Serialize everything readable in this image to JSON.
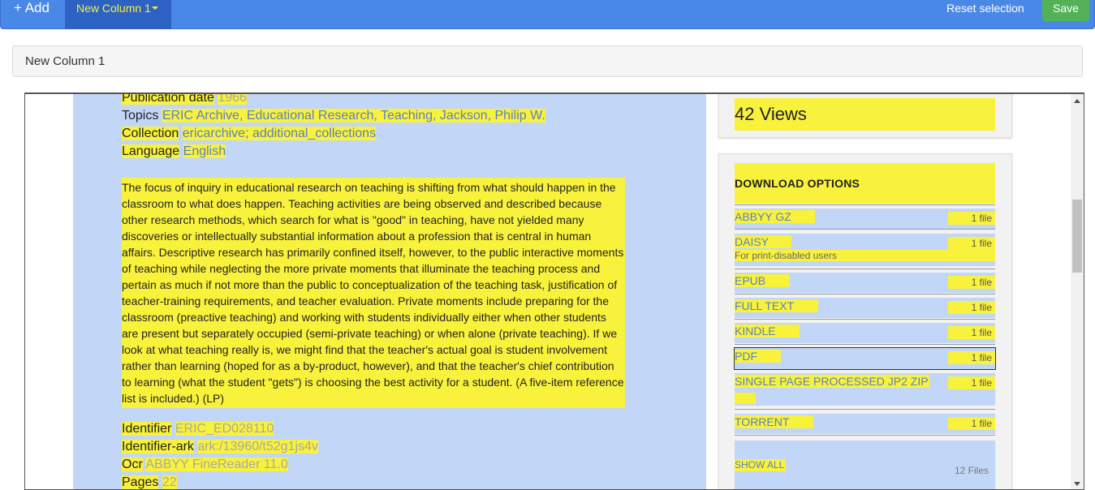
{
  "toolbar": {
    "add_label": "+ Add",
    "column_label": "New Column 1",
    "reset_label": "Reset selection",
    "save_label": "Save"
  },
  "column_name": "New Column 1",
  "metadata": {
    "publication_date": {
      "label": "Publication date",
      "value": "1966"
    },
    "topics": {
      "label": "Topics",
      "value": "ERIC Archive, Educational Research, Teaching, Jackson, Philip W."
    },
    "collection": {
      "label": "Collection",
      "value": "ericarchive; additional_collections"
    },
    "language": {
      "label": "Language",
      "value": "English"
    },
    "identifier": {
      "label": "Identifier",
      "value": "ERIC_ED028110"
    },
    "identifier_ark": {
      "label": "Identifier-ark",
      "value": "ark:/13960/t52g1js4v"
    },
    "ocr": {
      "label": "Ocr",
      "value": "ABBYY FineReader 11.0"
    },
    "pages": {
      "label": "Pages",
      "value": "22"
    }
  },
  "description": "The focus of inquiry in educational research on teaching is shifting from what should happen in the classroom to what does happen. Teaching activities are being observed and described because other research methods, which search for what is \"good\" in teaching, have not yielded many discoveries or intellectually substantial information about a profession that is central in human affairs. Descriptive research has primarily confined itself, however, to the public interactive moments of teaching while neglecting the more private moments that illuminate the teaching process and pertain as much if not more than the public to conceptualization of the teaching task, justification of teacher-training requirements, and teacher evaluation. Private moments include preparing for the classroom (preactive teaching) and working with students individually either when other students are present but separately occupied (semi-private teaching) or when alone (private teaching). If we look at what teaching really is, we might find that the teacher's actual goal is student involvement rather than learning (hoped for as a by-product, however), and that the teacher's chief contribution to learning (what the student \"gets\") is choosing the best activity for a student. (A five-item reference list is included.) (LP)",
  "views": "42 Views",
  "download": {
    "title": "DOWNLOAD OPTIONS",
    "items": [
      {
        "name": "ABBYY GZ",
        "count": "1 file"
      },
      {
        "name": "DAISY",
        "count": "1 file",
        "sub": "For print-disabled users"
      },
      {
        "name": "EPUB",
        "count": "1 file"
      },
      {
        "name": "FULL TEXT",
        "count": "1 file"
      },
      {
        "name": "KINDLE",
        "count": "1 file"
      },
      {
        "name": "PDF",
        "count": "1 file"
      },
      {
        "name": "SINGLE PAGE PROCESSED JP2 ZIP",
        "count": "1 file"
      },
      {
        "name": "TORRENT",
        "count": "1 file"
      }
    ],
    "show_all": "SHOW ALL",
    "files_count": "12 Files"
  }
}
